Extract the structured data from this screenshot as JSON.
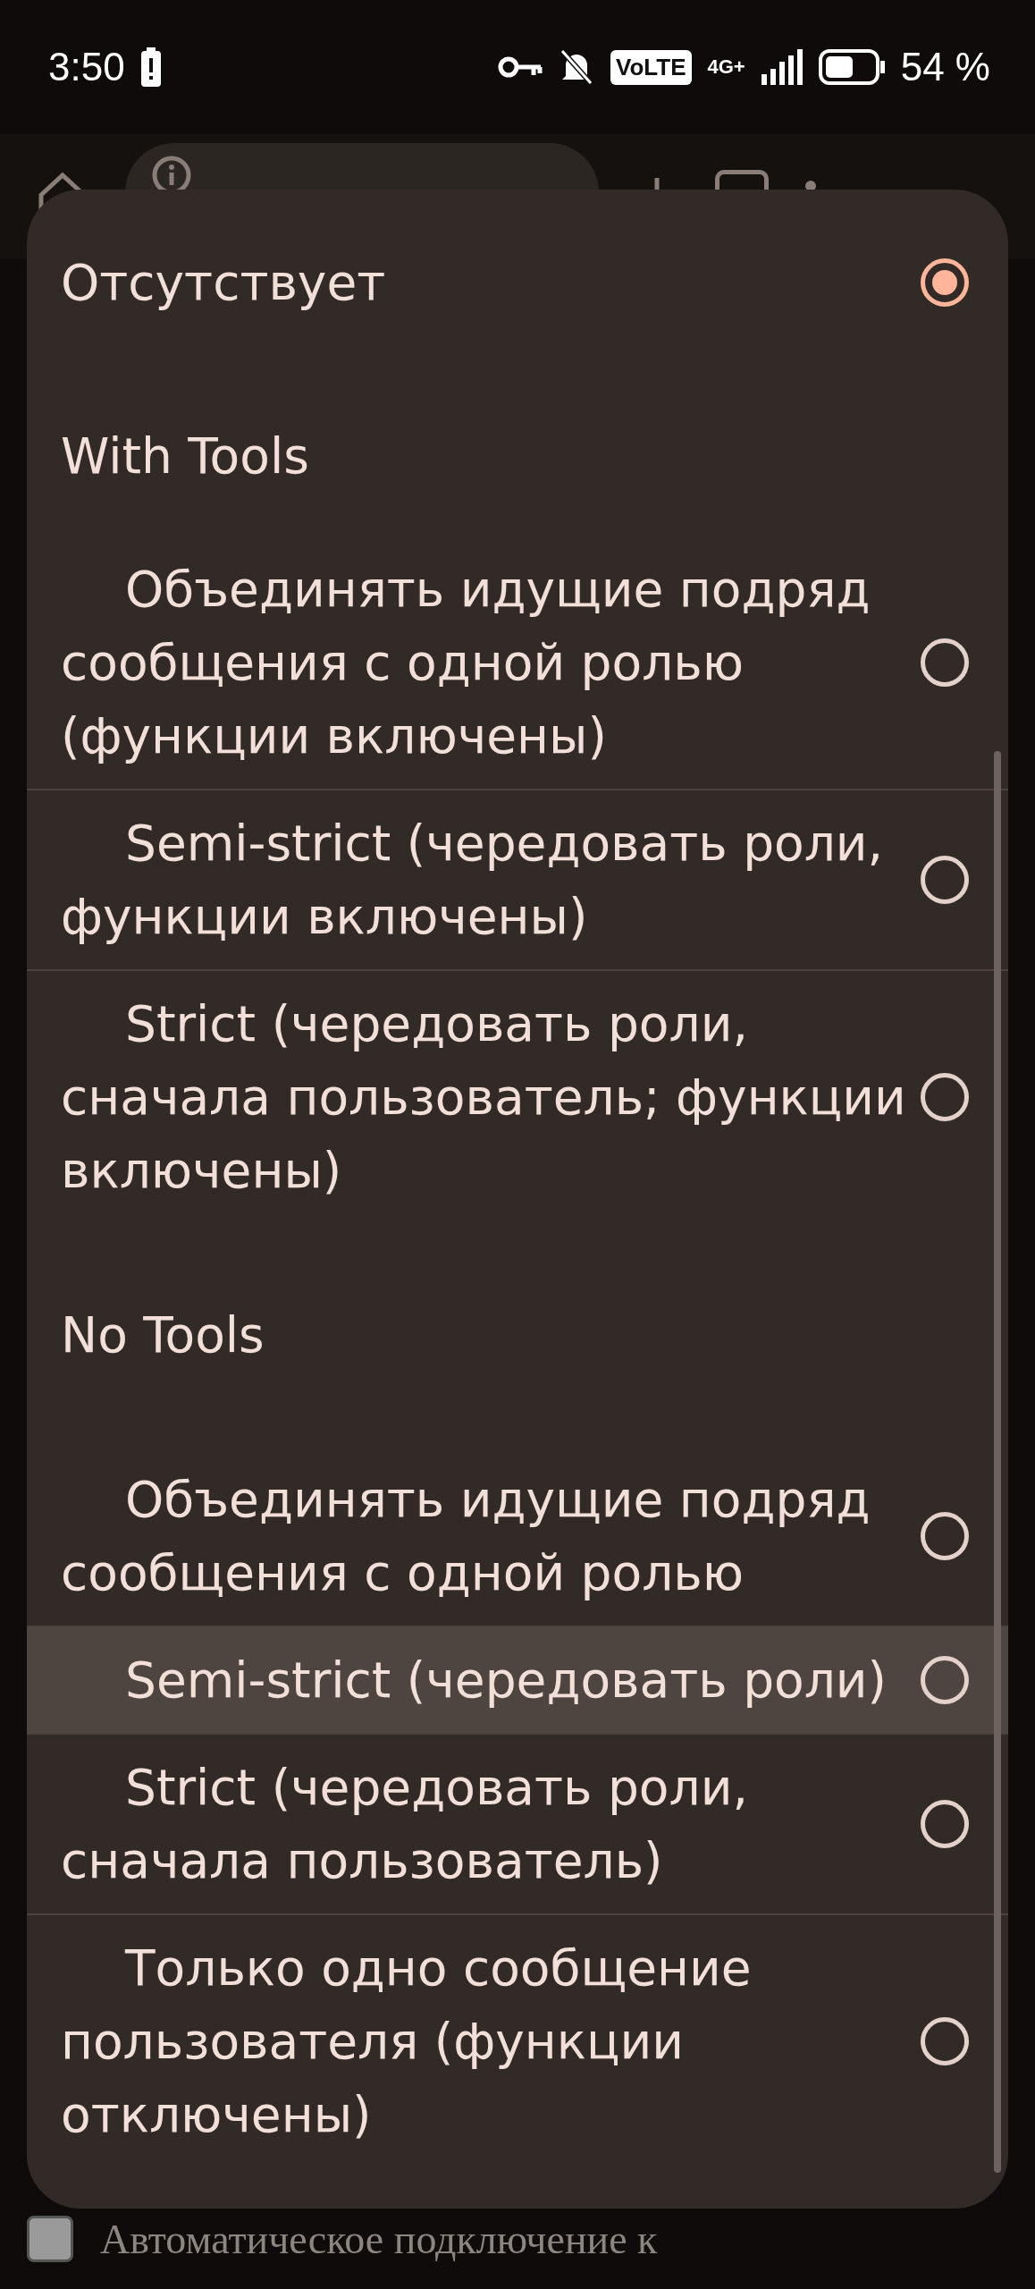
{
  "status_bar": {
    "time": "3:50",
    "network_label": "VoLTE",
    "network_type": "4G+",
    "battery": "54 %"
  },
  "dialog": {
    "top_option": {
      "label": "Отсутствует",
      "selected": true
    },
    "groups": [
      {
        "title": "With Tools",
        "options": [
          {
            "label": "Объединять идущие подряд сообщения с одной ролью (функции включены)",
            "selected": false,
            "pressed": false
          },
          {
            "label": "Semi-strict (чередовать роли, функции включены)",
            "selected": false,
            "pressed": false
          },
          {
            "label": "Strict (чередовать роли, сначала пользователь; функции включены)",
            "selected": false,
            "pressed": false
          }
        ]
      },
      {
        "title": "No Tools",
        "options": [
          {
            "label": "Объединять идущие подряд сообщения с одной ролью",
            "selected": false,
            "pressed": false
          },
          {
            "label": "Semi-strict (чередовать роли)",
            "selected": false,
            "pressed": true
          },
          {
            "label": "Strict (чередовать роли, сначала пользователь)",
            "selected": false,
            "pressed": false
          },
          {
            "label": "Только одно сообщение пользователя (функции отключены)",
            "selected": false,
            "pressed": false
          }
        ]
      }
    ]
  },
  "background": {
    "checkbox": {
      "label": "Автоматическое подключение к",
      "checked": false
    }
  }
}
